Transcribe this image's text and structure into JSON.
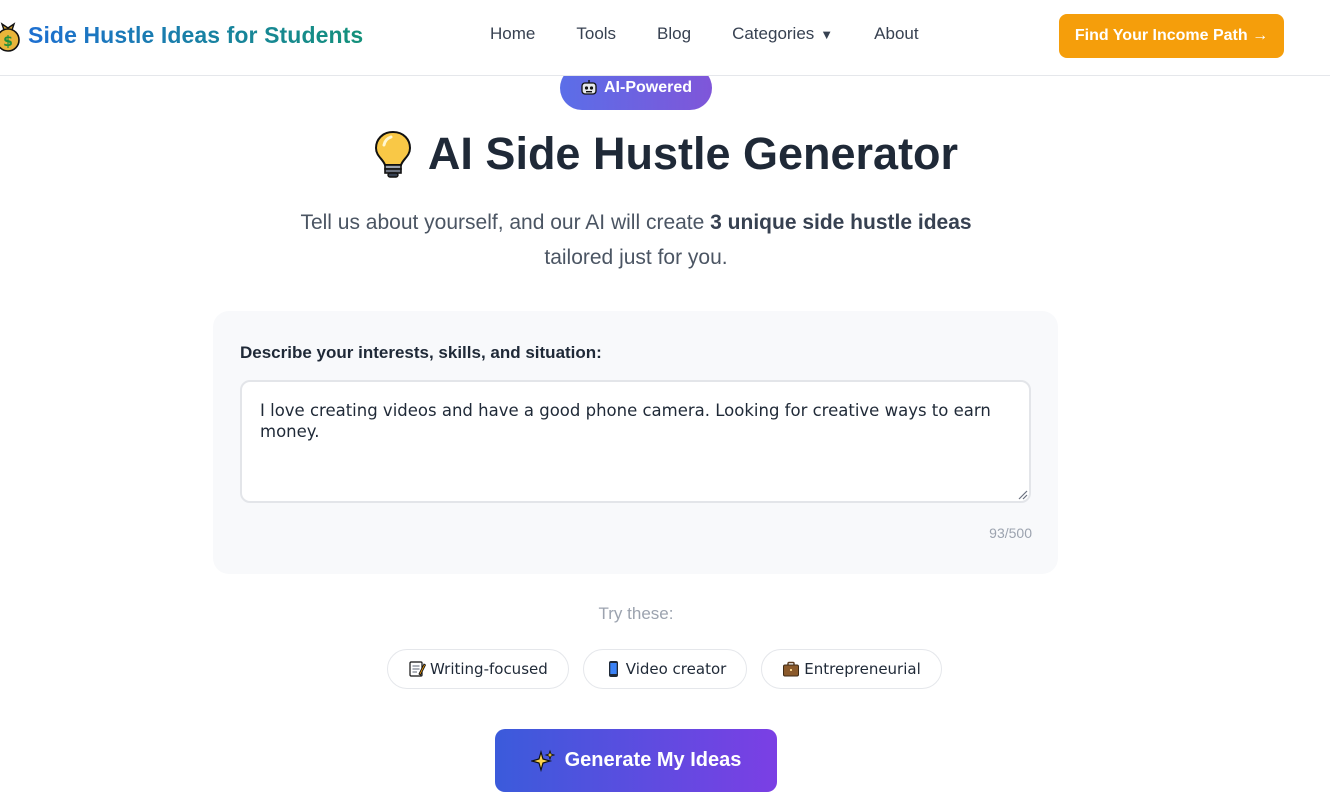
{
  "header": {
    "brand_icon": "money-bag-icon",
    "brand_title": "Side Hustle Ideas for Students",
    "nav": [
      {
        "label": "Home"
      },
      {
        "label": "Tools"
      },
      {
        "label": "Blog"
      },
      {
        "label": "Categories",
        "caret": "▼"
      },
      {
        "label": "About"
      }
    ],
    "cta_label": "Find Your Income Path →"
  },
  "badge": {
    "icon": "robot-icon",
    "label": "AI-Powered"
  },
  "hero": {
    "icon": "lightbulb-icon",
    "title": "AI Side Hustle Generator",
    "subtitle_pre": "Tell us about yourself, and our AI will create ",
    "subtitle_bold": "3 unique side hustle ideas",
    "subtitle_post": " tailored just for you."
  },
  "form": {
    "label": "Describe your interests, skills, and situation:",
    "value": "I love creating videos and have a good phone camera. Looking for creative ways to earn money.",
    "counter": "93/500"
  },
  "suggestions": {
    "label": "Try these:",
    "chips": [
      {
        "icon": "memo-icon",
        "label": "Writing-focused"
      },
      {
        "icon": "phone-icon",
        "label": "Video creator"
      },
      {
        "icon": "briefcase-icon",
        "label": "Entrepreneurial"
      }
    ]
  },
  "generate": {
    "icon": "sparkles-icon",
    "label": "Generate My Ideas"
  },
  "colors": {
    "cta": "#f59e0b",
    "badge_start": "#5b6ee8",
    "badge_end": "#7f56d9",
    "generate_start": "#3b5bdb",
    "generate_end": "#7b3fe4",
    "brand_start": "#1d6fd1",
    "brand_end": "#14917a"
  }
}
